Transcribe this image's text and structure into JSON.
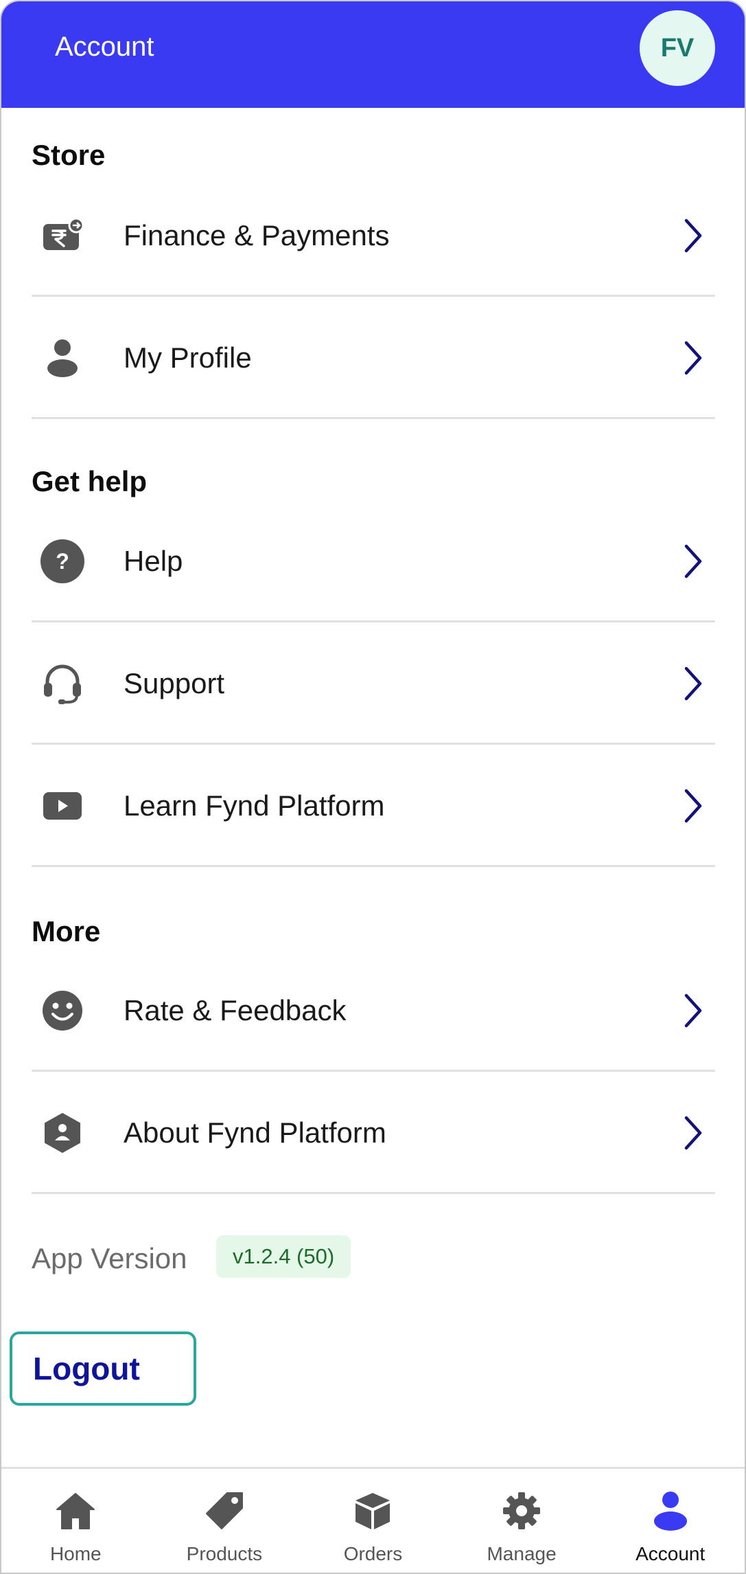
{
  "header": {
    "title": "Account",
    "avatar_initials": "FV"
  },
  "sections": {
    "store": {
      "title": "Store",
      "items": [
        {
          "label": "Finance & Payments",
          "icon": "rupee-wallet-icon"
        },
        {
          "label": "My Profile",
          "icon": "person-icon"
        }
      ]
    },
    "get_help": {
      "title": "Get help",
      "items": [
        {
          "label": "Help",
          "icon": "question-circle-icon"
        },
        {
          "label": "Support",
          "icon": "headset-icon"
        },
        {
          "label": "Learn Fynd Platform",
          "icon": "video-play-icon"
        }
      ]
    },
    "more": {
      "title": "More",
      "items": [
        {
          "label": "Rate & Feedback",
          "icon": "smiley-icon"
        },
        {
          "label": "About Fynd Platform",
          "icon": "hexagon-person-icon"
        }
      ]
    }
  },
  "app_version": {
    "label": "App Version",
    "value": "v1.2.4 (50)"
  },
  "logout_label": "Logout",
  "bottom_nav": {
    "items": [
      {
        "label": "Home",
        "icon": "home-icon"
      },
      {
        "label": "Products",
        "icon": "tag-icon"
      },
      {
        "label": "Orders",
        "icon": "box-icon"
      },
      {
        "label": "Manage",
        "icon": "gear-icon"
      },
      {
        "label": "Account",
        "icon": "person-icon",
        "active": true
      }
    ]
  },
  "colors": {
    "header_bg": "#3a3af2",
    "chevron": "#12127a",
    "icon_gray": "#555555",
    "active_nav": "#3a3af2",
    "logout_border": "#2aa79b",
    "version_badge_bg": "#e5f7e8",
    "version_badge_text": "#1d6b2b"
  }
}
